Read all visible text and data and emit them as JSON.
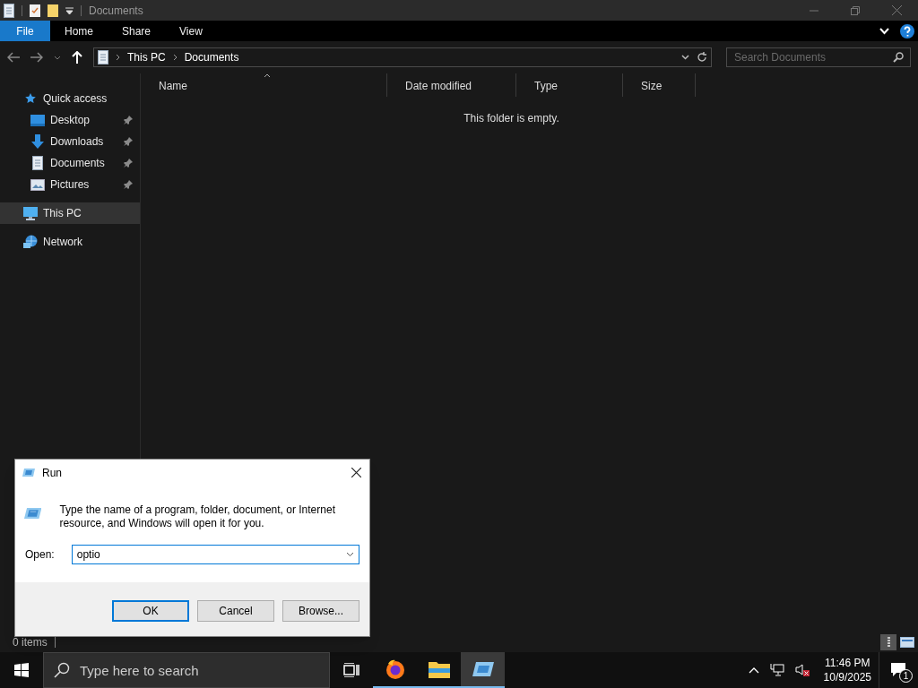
{
  "window": {
    "title": "Documents"
  },
  "ribbon": {
    "tabs": [
      {
        "label": "File",
        "selected": true
      },
      {
        "label": "Home",
        "selected": false
      },
      {
        "label": "Share",
        "selected": false
      },
      {
        "label": "View",
        "selected": false
      }
    ]
  },
  "address_bar": {
    "path": [
      "This PC",
      "Documents"
    ]
  },
  "search": {
    "placeholder": "Search Documents"
  },
  "sidebar": {
    "items": [
      {
        "label": "Quick access",
        "kind": "star",
        "selected": false,
        "children": [
          {
            "label": "Desktop",
            "kind": "desktop",
            "selected": false,
            "pinned": true
          },
          {
            "label": "Downloads",
            "kind": "download",
            "selected": false,
            "pinned": true
          },
          {
            "label": "Documents",
            "kind": "document",
            "selected": false,
            "pinned": true
          },
          {
            "label": "Pictures",
            "kind": "picture",
            "selected": false,
            "pinned": true
          }
        ]
      },
      {
        "label": "This PC",
        "kind": "pc",
        "selected": true
      },
      {
        "label": "Network",
        "kind": "network",
        "selected": false
      }
    ]
  },
  "columns": [
    {
      "label": "Name",
      "sorted": true
    },
    {
      "label": "Date modified",
      "sorted": false
    },
    {
      "label": "Type",
      "sorted": false
    },
    {
      "label": "Size",
      "sorted": false
    }
  ],
  "empty_message": "This folder is empty.",
  "status_bar": {
    "text": "0 items"
  },
  "run_dialog": {
    "title": "Run",
    "message": "Type the name of a program, folder, document, or Internet resource, and Windows will open it for you.",
    "open_label": "Open:",
    "value": "optio",
    "buttons": [
      {
        "label": "OK",
        "default": true
      },
      {
        "label": "Cancel",
        "default": false
      },
      {
        "label": "Browse...",
        "default": false
      }
    ]
  },
  "taskbar": {
    "search_placeholder": "Type here to search",
    "apps": [
      {
        "kind": "firefox",
        "active": false,
        "running": true
      },
      {
        "kind": "explorer",
        "active": false,
        "running": true
      },
      {
        "kind": "run",
        "active": true,
        "running": true
      }
    ],
    "time": "11:46 PM",
    "date": "10/9/2025",
    "notifications": "1"
  }
}
